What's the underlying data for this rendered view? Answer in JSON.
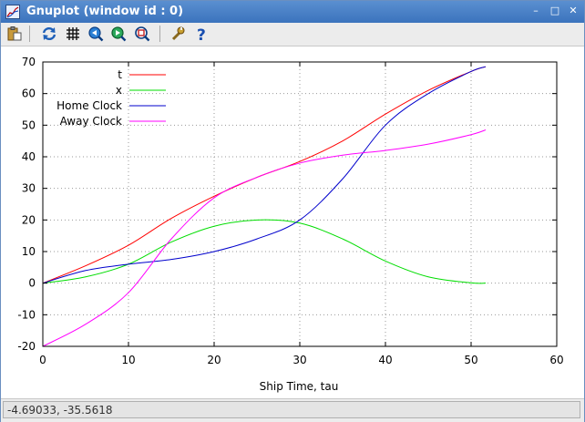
{
  "window": {
    "title": "Gnuplot (window id : 0)",
    "controls": {
      "minimize": "–",
      "maximize": "□",
      "close": "✕"
    }
  },
  "toolbar": {
    "buttons": [
      {
        "name": "copy-clipboard",
        "icon": "clipboard-icon"
      },
      {
        "name": "replot",
        "icon": "refresh-icon"
      },
      {
        "name": "toggle-grid",
        "icon": "grid-icon"
      },
      {
        "name": "zoom-previous",
        "icon": "zoom-previous-icon"
      },
      {
        "name": "zoom-next",
        "icon": "zoom-next-icon"
      },
      {
        "name": "autoscale",
        "icon": "autoscale-icon"
      },
      {
        "name": "config",
        "icon": "wrench-icon"
      },
      {
        "name": "help",
        "icon": "help-icon"
      }
    ]
  },
  "status": {
    "coordinates": "-4.69033, -35.5618"
  },
  "chart_data": {
    "type": "line",
    "title": "",
    "xlabel": "Ship Time, tau",
    "ylabel": "",
    "xlim": [
      0,
      60
    ],
    "ylim": [
      -20,
      70
    ],
    "xticks": [
      "0",
      "10",
      "20",
      "30",
      "40",
      "50",
      "60"
    ],
    "yticks": [
      "70",
      "60",
      "50",
      "40",
      "30",
      "20",
      "10",
      "0",
      "-10",
      "-20"
    ],
    "grid": true,
    "legend_position": "top-left",
    "series": [
      {
        "name": "t",
        "color": "#ff0000",
        "x": [
          0,
          5,
          10,
          15,
          20,
          25,
          30,
          35,
          40,
          45,
          50,
          51.7
        ],
        "y": [
          0,
          5.5,
          12,
          20.5,
          27.5,
          33.5,
          38.5,
          45,
          53.5,
          61,
          67,
          68.5
        ]
      },
      {
        "name": "x",
        "color": "#00dd00",
        "x": [
          0,
          5,
          10,
          15,
          20,
          25,
          30,
          35,
          40,
          45,
          50,
          51.7
        ],
        "y": [
          0,
          2,
          6,
          13,
          18,
          20,
          19,
          14,
          7,
          2,
          0.1,
          0
        ]
      },
      {
        "name": "Home Clock",
        "color": "#0000cc",
        "x": [
          0,
          5,
          10,
          15,
          20,
          25,
          30,
          35,
          40,
          45,
          50,
          51.7
        ],
        "y": [
          0,
          4,
          6,
          7.5,
          10,
          14,
          20,
          33,
          50,
          60,
          67,
          68.5
        ]
      },
      {
        "name": "Away Clock",
        "color": "#ff00ff",
        "x": [
          0,
          5,
          10,
          15,
          20,
          25,
          30,
          35,
          40,
          45,
          50,
          51.7
        ],
        "y": [
          -20,
          -13,
          -3,
          14,
          27,
          33.5,
          38,
          40.5,
          42,
          44,
          47,
          48.5
        ]
      }
    ]
  }
}
